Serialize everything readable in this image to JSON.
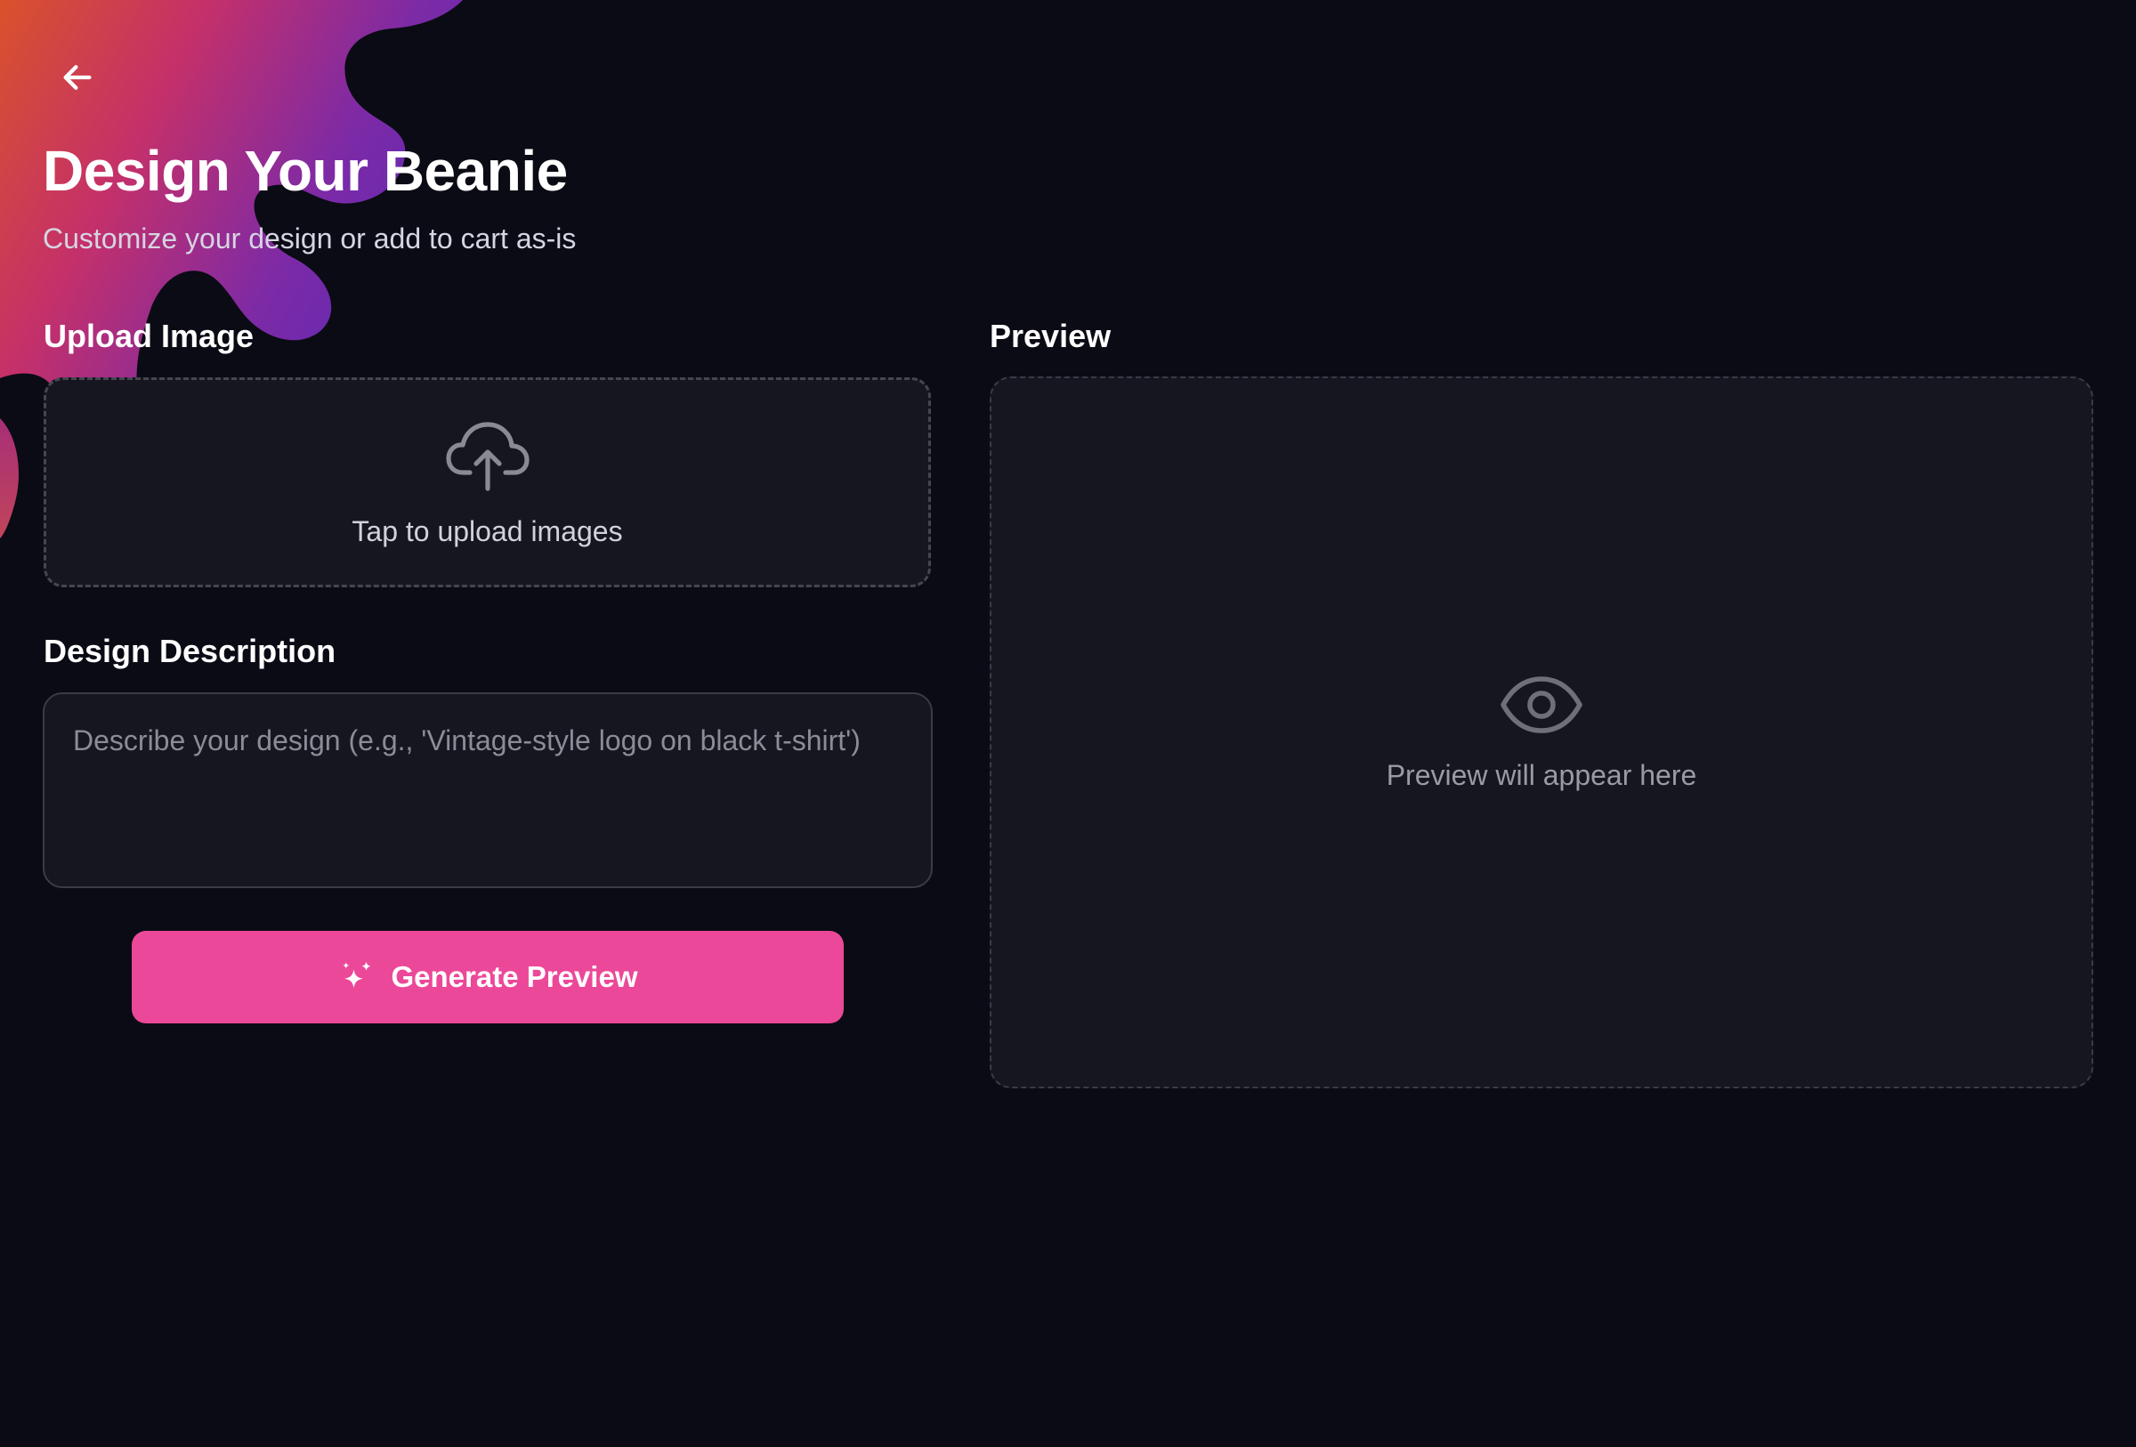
{
  "header": {
    "back_icon": "arrow-left-icon",
    "title": "Design Your Beanie",
    "subtitle": "Customize your design or add to cart as-is"
  },
  "upload": {
    "label": "Upload Image",
    "icon": "cloud-upload-icon",
    "prompt": "Tap to upload images"
  },
  "description": {
    "label": "Design Description",
    "value": "",
    "placeholder": "Describe your design (e.g., 'Vintage-style logo on black t-shirt')"
  },
  "generate_button": {
    "icon": "sparkles-icon",
    "label": "Generate Preview"
  },
  "preview": {
    "label": "Preview",
    "icon": "eye-icon",
    "placeholder_text": "Preview will appear here"
  },
  "colors": {
    "background": "#0a0b14",
    "panel": "#15161f",
    "accent": "#ec4899",
    "blob_gradient": [
      "#d94f2a",
      "#c2306b",
      "#7b2aa8",
      "#5b2bb4"
    ]
  }
}
